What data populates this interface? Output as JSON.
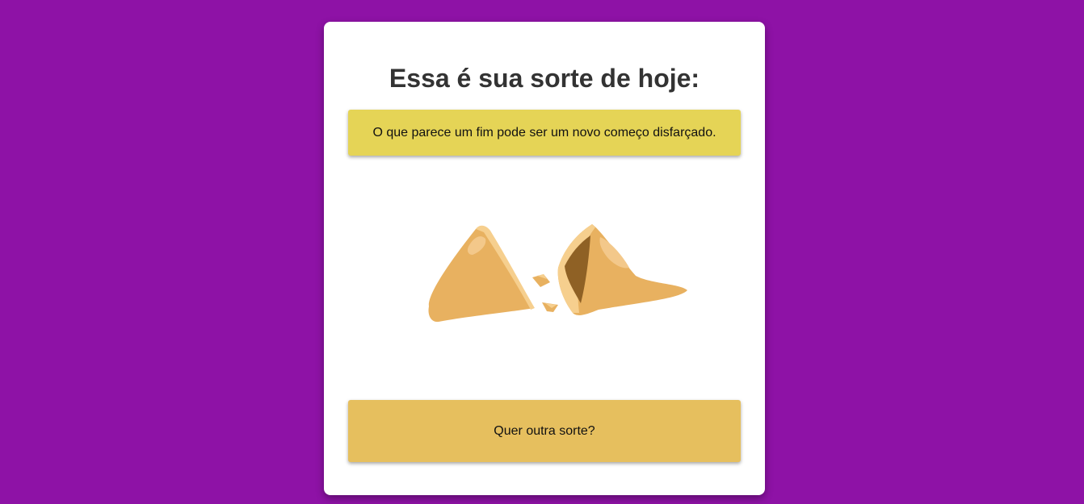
{
  "page": {
    "background_color": "#8e12a6"
  },
  "card": {
    "title": "Essa é sua sorte de hoje:",
    "fortune_text": "O que parece um fim pode ser um novo começo disfarçado.",
    "fortune_bg": "#e5d456",
    "image_icon": "broken-fortune-cookie",
    "button_label": "Quer outra sorte?",
    "button_bg": "#e6bf5e"
  }
}
